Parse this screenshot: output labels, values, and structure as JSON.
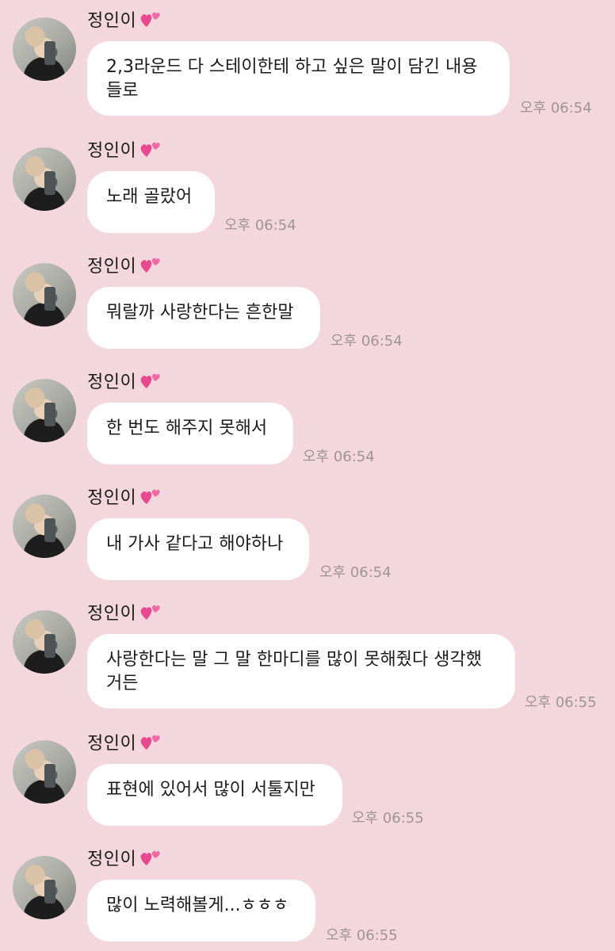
{
  "chat": {
    "messages": [
      {
        "sender": "정인이",
        "text": "2,3라운드 다 스테이한테 하고 싶은 말이 담긴 내용 들로",
        "time": "오후 06:54"
      },
      {
        "sender": "정인이",
        "text": "노래 골랐어",
        "time": "오후 06:54"
      },
      {
        "sender": "정인이",
        "text": "뭐랄까 사랑한다는 흔한말",
        "time": "오후 06:54"
      },
      {
        "sender": "정인이",
        "text": "한 번도 해주지 못해서",
        "time": "오후 06:54"
      },
      {
        "sender": "정인이",
        "text": "내 가사 같다고 해야하나",
        "time": "오후 06:54"
      },
      {
        "sender": "정인이",
        "text": "사랑한다는 말 그 말 한마디를 많이 못해줬다 생각했 거든",
        "time": "오후 06:55"
      },
      {
        "sender": "정인이",
        "text": "표현에 있어서 많이 서툴지만",
        "time": "오후 06:55"
      },
      {
        "sender": "정인이",
        "text": "많이 노력해볼게...ㅎㅎㅎ",
        "time": "오후 06:55"
      }
    ]
  },
  "icons": {
    "heart": "two-hearts-icon",
    "heart_color": "#e8488f"
  }
}
